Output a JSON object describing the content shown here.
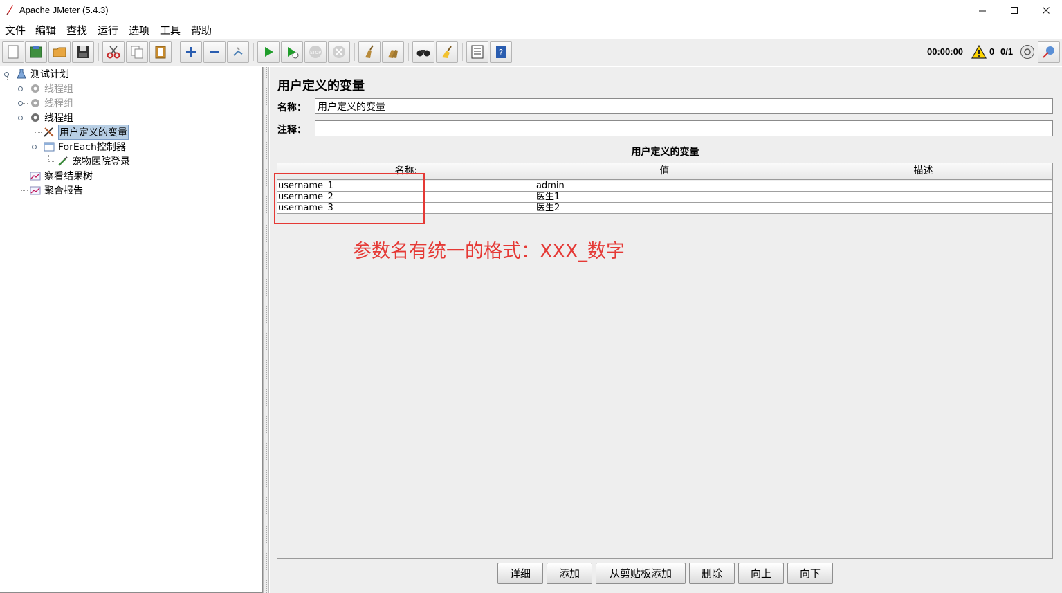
{
  "window": {
    "title": "Apache JMeter (5.4.3)",
    "controls": [
      "—",
      "☐",
      "✕"
    ]
  },
  "menu": [
    "文件",
    "编辑",
    "查找",
    "运行",
    "选项",
    "工具",
    "帮助"
  ],
  "toolbar": {
    "timer": "00:00:00",
    "warnings": "0",
    "threads": "0/1"
  },
  "tree": {
    "items": [
      {
        "label": "测试计划",
        "icon": "flask-icon",
        "enabled": true
      },
      {
        "label": "线程组",
        "icon": "gear-icon",
        "enabled": false
      },
      {
        "label": "线程组",
        "icon": "gear-icon",
        "enabled": false
      },
      {
        "label": "线程组",
        "icon": "gear-icon",
        "enabled": true
      },
      {
        "label": "用户定义的变量",
        "icon": "wrench-icon",
        "enabled": true,
        "selected": true
      },
      {
        "label": "ForEach控制器",
        "icon": "foreach-controller-icon",
        "enabled": true
      },
      {
        "label": "宠物医院登录",
        "icon": "pipette-icon",
        "enabled": true
      },
      {
        "label": "察看结果树",
        "icon": "listener-chart-icon",
        "enabled": true
      },
      {
        "label": "聚合报告",
        "icon": "listener-chart-icon",
        "enabled": true
      }
    ]
  },
  "panel": {
    "title": "用户定义的变量",
    "name_label": "名称：",
    "name_value": "用户定义的变量",
    "comment_label": "注释：",
    "comment_value": "",
    "table_title": "用户定义的变量",
    "columns": [
      "名称:",
      "值",
      "描述"
    ],
    "rows": [
      [
        "username_1",
        "admin",
        ""
      ],
      [
        "username_2",
        "医生1",
        ""
      ],
      [
        "username_3",
        "医生2",
        ""
      ]
    ]
  },
  "annotation": {
    "text": "参数名有统一的格式：XXX_数字",
    "color": "#e53935"
  },
  "buttons": [
    "详细",
    "添加",
    "从剪贴板添加",
    "删除",
    "向上",
    "向下"
  ]
}
